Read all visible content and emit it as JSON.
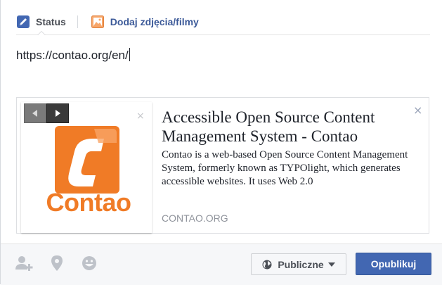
{
  "tabs": {
    "status_label": "Status",
    "photos_label": "Dodaj zdjęcia/filmy",
    "status_icon": "pencil-icon",
    "photos_icon": "photo-icon"
  },
  "composer": {
    "text": "https://contao.org/en/"
  },
  "link_preview": {
    "title": "Accessible Open Source Content Management System - Contao",
    "description": "Contao is a web-based Open Source Content Management System, formerly known as TYPOlight, which generates accessible websites. It uses Web 2.0",
    "domain": "CONTAO.ORG",
    "close_symbol": "×",
    "thumbnail": {
      "logo_text": "Contao",
      "remove_symbol": "×",
      "brand_color": "#f07b26"
    }
  },
  "footer": {
    "icons": [
      "tag-friends-icon",
      "location-pin-icon",
      "feeling-smiley-icon"
    ],
    "audience_label": "Publiczne",
    "audience_icon": "globe-icon",
    "publish_label": "Opublikuj",
    "publish_color": "#4267b2"
  }
}
